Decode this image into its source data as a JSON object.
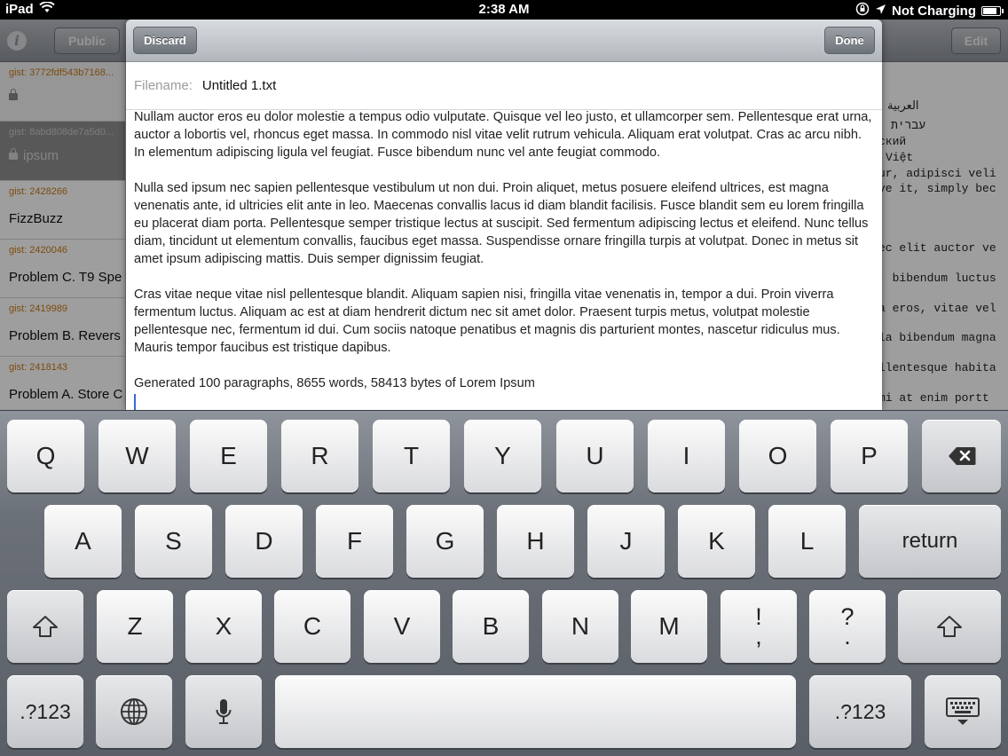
{
  "status_bar": {
    "device": "iPad",
    "time": "2:38 AM",
    "charging": "Not Charging"
  },
  "background_app": {
    "toolbar": {
      "public_label": "Public",
      "edit_label": "Edit"
    },
    "sidebar": {
      "items": [
        {
          "gist": "gist: 3772fdf543b7168...",
          "title": ""
        },
        {
          "gist": "gist: 8abd808de7a5d0...",
          "title": "ipsum"
        },
        {
          "gist": "gist: 2428266",
          "title": "FizzBuzz"
        },
        {
          "gist": "gist: 2420046",
          "title": "Problem C. T9 Spe"
        },
        {
          "gist": "gist: 2419989",
          "title": "Problem B. Revers"
        },
        {
          "gist": "gist: 2418143",
          "title": "Problem A. Store C"
        }
      ]
    },
    "right_pane_lines": [
      "العربية",
      "עברית",
      "ский",
      "Việt",
      "ur, adipisci veli",
      "ve it, simply bec",
      "ec elit auctor ve",
      ", bibendum luctus",
      "a eros, vitae vel",
      "la bibendum magna",
      "llentesque habita",
      " mi at enim portt"
    ]
  },
  "editor": {
    "discard_label": "Discard",
    "done_label": "Done",
    "filename_label": "Filename:",
    "filename_value": "Untitled 1.txt",
    "paragraphs": [
      "Nullam auctor eros eu dolor molestie a tempus odio vulputate. Quisque vel leo justo, et ullamcorper sem. Pellentesque erat urna, auctor a lobortis vel, rhoncus eget massa. In commodo nisl vitae velit rutrum vehicula. Aliquam erat volutpat. Cras ac arcu nibh. In elementum adipiscing ligula vel feugiat. Fusce bibendum nunc vel ante feugiat commodo.",
      "Nulla sed ipsum nec sapien pellentesque vestibulum ut non dui. Proin aliquet, metus posuere eleifend ultrices, est magna venenatis ante, id ultricies elit ante in leo. Maecenas convallis lacus id diam blandit facilisis. Fusce blandit sem eu lorem fringilla eu placerat diam porta. Pellentesque semper tristique lectus at suscipit. Sed fermentum adipiscing lectus et eleifend. Nunc tellus diam, tincidunt ut elementum convallis, faucibus eget massa. Suspendisse ornare fringilla turpis at volutpat. Donec in metus sit amet ipsum adipiscing mattis. Duis semper dignissim feugiat.",
      "Cras vitae neque vitae nisl pellentesque blandit. Aliquam sapien nisi, fringilla vitae venenatis in, tempor a dui. Proin viverra fermentum luctus. Aliquam ac est at diam hendrerit dictum nec sit amet dolor. Praesent turpis metus, volutpat molestie pellentesque nec, fermentum id dui. Cum sociis natoque penatibus et magnis dis parturient montes, nascetur ridiculus mus. Mauris tempor faucibus est tristique dapibus.",
      "Generated 100 paragraphs, 8655 words, 58413 bytes of Lorem Ipsum"
    ]
  },
  "keyboard": {
    "row1": [
      "Q",
      "W",
      "E",
      "R",
      "T",
      "Y",
      "U",
      "I",
      "O",
      "P"
    ],
    "row2": [
      "A",
      "S",
      "D",
      "F",
      "G",
      "H",
      "J",
      "K",
      "L"
    ],
    "row3": [
      "Z",
      "X",
      "C",
      "V",
      "B",
      "N",
      "M"
    ],
    "return_label": "return",
    "exclaim_top": "!",
    "exclaim_bottom": ",",
    "question_top": "?",
    "question_bottom": ".",
    "numbers_label": ".?123",
    "icons": [
      "backspace-icon",
      "shift-icon",
      "globe-icon",
      "microphone-icon",
      "hide-keyboard-icon",
      "wifi-icon",
      "battery-icon",
      "location-icon",
      "rotation-lock-icon"
    ]
  }
}
